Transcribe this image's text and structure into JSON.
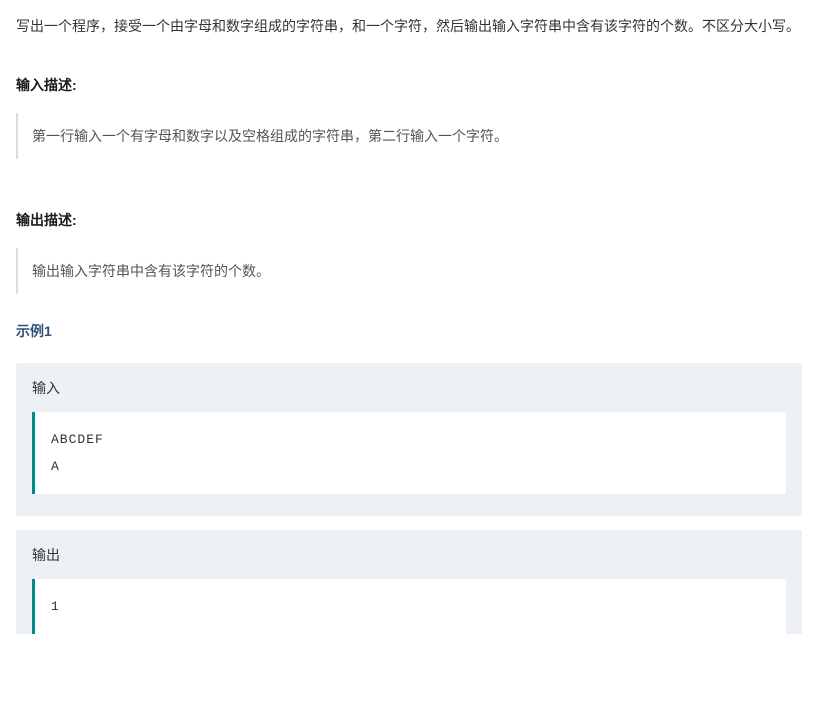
{
  "problem": {
    "description": "写出一个程序，接受一个由字母和数字组成的字符串，和一个字符，然后输出输入字符串中含有该字符的个数。不区分大小写。"
  },
  "input_section": {
    "heading": "输入描述:",
    "text": "第一行输入一个有字母和数字以及空格组成的字符串，第二行输入一个字符。"
  },
  "output_section": {
    "heading": "输出描述:",
    "text": "输出输入字符串中含有该字符的个数。"
  },
  "example": {
    "heading": "示例1",
    "input_label": "输入",
    "input_code": "ABCDEF\nA",
    "output_label": "输出",
    "output_code": "1"
  }
}
